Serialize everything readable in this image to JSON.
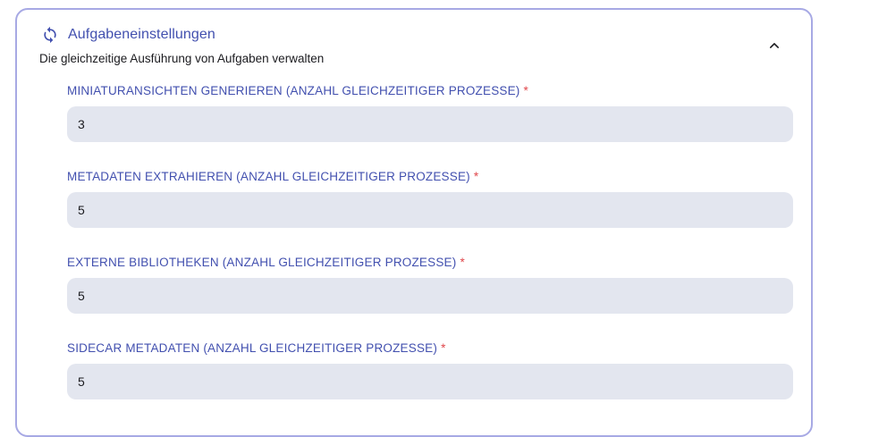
{
  "section": {
    "title": "Aufgabeneinstellungen",
    "subtitle": "Die gleichzeitige Ausführung von Aufgaben verwalten",
    "icon": "sync-icon",
    "collapse_icon": "chevron-up-icon",
    "accent_color": "#4250af",
    "border_color": "#a7a9e4",
    "required_color": "#e0474b"
  },
  "fields": [
    {
      "label": "MINIATURANSICHTEN GENERIEREN (ANZAHL GLEICHZEITIGER PROZESSE)",
      "required_marker": "*",
      "value": "3"
    },
    {
      "label": "METADATEN EXTRAHIEREN (ANZAHL GLEICHZEITIGER PROZESSE)",
      "required_marker": "*",
      "value": "5"
    },
    {
      "label": "EXTERNE BIBLIOTHEKEN (ANZAHL GLEICHZEITIGER PROZESSE)",
      "required_marker": "*",
      "value": "5"
    },
    {
      "label": "SIDECAR METADATEN (ANZAHL GLEICHZEITIGER PROZESSE)",
      "required_marker": "*",
      "value": "5"
    }
  ]
}
